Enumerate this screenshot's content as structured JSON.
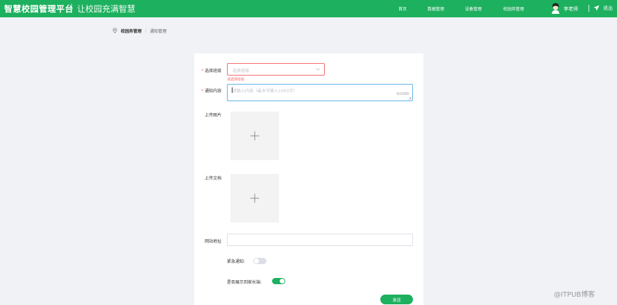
{
  "header": {
    "brand": "智慧校园管理平台",
    "separator": "|",
    "slogan": "让校园充满智慧",
    "nav": [
      "首页",
      "数据管理",
      "设备管理",
      "校园务管理"
    ],
    "user_name": "李老师",
    "logout": "退出",
    "bg_color": "#1db05f"
  },
  "breadcrumb": {
    "icon": "location-pin-icon",
    "items": [
      "校园务管理",
      "通知管理"
    ],
    "separator": "/"
  },
  "form": {
    "class_label": "选择班级",
    "class_placeholder": "选择班级",
    "class_error": "请选择班级",
    "content_label": "通知内容",
    "content_placeholder": "请输入内容（最多可输入1000字）",
    "content_count": "0/1000",
    "image_label": "上传图片",
    "doc_label": "上传文档",
    "url_label": "网站地址",
    "url_value": "",
    "urgent_label": "紧急通知:",
    "urgent_on": false,
    "show_parents_label": "是否展示到家长端:",
    "show_parents_on": true,
    "submit_label": "发送",
    "required_mark": "*"
  },
  "watermark": "@ITPUB博客"
}
